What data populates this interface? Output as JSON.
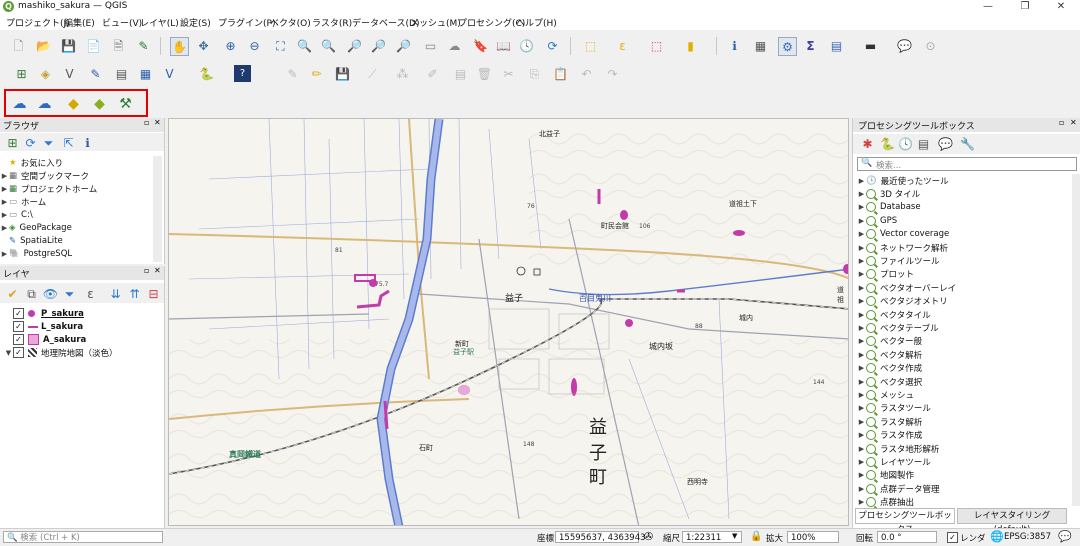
{
  "window": {
    "title": "mashiko_sakura — QGIS"
  },
  "menu": [
    "プロジェクト(J)",
    "編集(E)",
    "ビュー(V)",
    "レイヤ(L)",
    "設定(S)",
    "プラグイン(P)",
    "ベクタ(O)",
    "ラスタ(R)",
    "データベース(D)",
    "メッシュ(M)",
    "プロセシング(C)",
    "ヘルプ(H)"
  ],
  "colors": {
    "highlight": "#e30000",
    "qgis_green": "#589632",
    "map_bg": "#f6f4ef",
    "river": "#6f8fd8",
    "sakura": "#c43aa8"
  },
  "browser": {
    "title": "ブラウザ",
    "items": [
      "お気に入り",
      "空間ブックマーク",
      "プロジェクトホーム",
      "ホーム",
      "C:\\",
      "GeoPackage",
      "SpatiaLite",
      "PostgreSQL"
    ]
  },
  "layers": {
    "title": "レイヤ",
    "items": [
      {
        "name": "P_sakura",
        "checked": "✓"
      },
      {
        "name": "L_sakura",
        "checked": "✓"
      },
      {
        "name": "A_sakura",
        "checked": "✓"
      },
      {
        "name": "地理院地図（淡色）",
        "checked": "✓"
      }
    ]
  },
  "map_labels": {
    "town_kanji": [
      "益",
      "子",
      "町"
    ],
    "places": [
      "益子",
      "北益子",
      "益子駅",
      "新町",
      "城内坂",
      "百目鬼川",
      "町民会館",
      "道祖土下",
      "真岡鐵道",
      "西明寺",
      "城内",
      "道祖",
      "石町"
    ],
    "numbers": [
      "76",
      "81",
      "106",
      "88",
      "148",
      "144",
      "75.7"
    ]
  },
  "processing": {
    "title": "プロセシングツールボックス",
    "search_placeholder": "検索...",
    "recent": "最近使ったツール",
    "items": [
      "3D タイル",
      "Database",
      "GPS",
      "Vector coverage",
      "ネットワーク解析",
      "ファイルツール",
      "プロット",
      "ベクタオーバーレイ",
      "ベクタジオメトリ",
      "ベクタタイル",
      "ベクタテーブル",
      "ベクター般",
      "ベクタ解析",
      "ベクタ作成",
      "ベクタ選択",
      "メッシュ",
      "ラスタツール",
      "ラスタ解析",
      "ラスタ作成",
      "ラスタ地形解析",
      "レイヤツール",
      "地図製作",
      "点群データ管理",
      "点群抽出"
    ],
    "tab_active": "プロセシングツールボックス",
    "tab_other": "レイヤスタイリング (default)"
  },
  "status": {
    "search_placeholder": "検索 (Ctrl + K)",
    "coord_label": "座標",
    "coord_value": "15595637, 4363943",
    "scale_label": "縮尺",
    "scale_value": "1:22311",
    "magnifier_label": "拡大",
    "magnifier_value": "100%",
    "rotation_label": "回転",
    "rotation_value": "0.0 °",
    "render_label": "レンダ",
    "crs": "EPSG:3857"
  }
}
